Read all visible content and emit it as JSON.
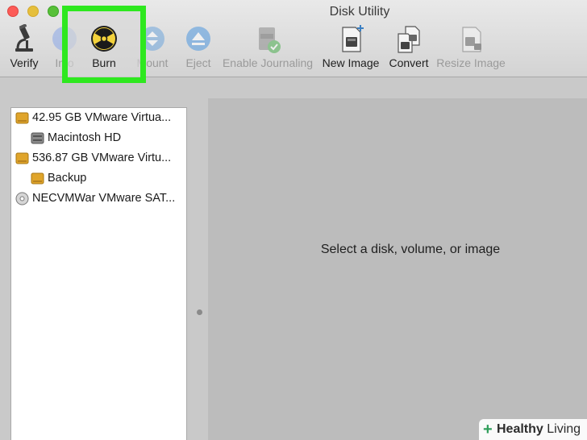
{
  "window": {
    "title": "Disk Utility"
  },
  "toolbar": {
    "items": [
      {
        "label": "Verify",
        "icon": "microscope-icon",
        "enabled": true
      },
      {
        "label": "Info",
        "icon": "info-icon",
        "enabled": false
      },
      {
        "label": "Burn",
        "icon": "burn-radiation-icon",
        "enabled": true
      },
      {
        "label": "Mount",
        "icon": "mount-icon",
        "enabled": false
      },
      {
        "label": "Eject",
        "icon": "eject-icon",
        "enabled": false
      },
      {
        "label": "Enable Journaling",
        "icon": "journaling-icon",
        "enabled": false
      },
      {
        "label": "New Image",
        "icon": "new-image-icon",
        "enabled": true
      },
      {
        "label": "Convert",
        "icon": "convert-icon",
        "enabled": true
      },
      {
        "label": "Resize Image",
        "icon": "resize-image-icon",
        "enabled": false
      }
    ]
  },
  "sidebar": {
    "items": [
      {
        "label": "42.95 GB VMware Virtua...",
        "icon": "hard-drive-icon"
      },
      {
        "label": "Macintosh HD",
        "icon": "volume-icon"
      },
      {
        "label": "536.87 GB VMware Virtu...",
        "icon": "hard-drive-icon"
      },
      {
        "label": "Backup",
        "icon": "volume-icon"
      },
      {
        "label": "NECVMWar VMware SAT...",
        "icon": "optical-drive-icon"
      }
    ]
  },
  "content": {
    "placeholder": "Select a disk, volume, or image"
  },
  "watermark": {
    "plus": "+",
    "brand_bold": "Healthy",
    "brand_light": " Living"
  },
  "colors": {
    "highlight": "#2ee81f",
    "drive": "#e0a52b",
    "accent_blue": "#5b9fe0"
  }
}
